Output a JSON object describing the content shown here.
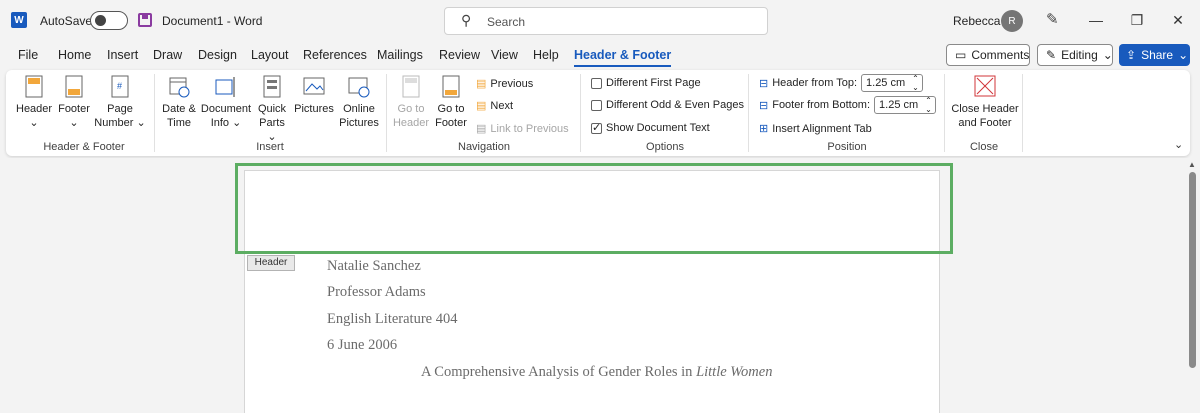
{
  "titlebar": {
    "app_icon": "W",
    "autosave_label": "AutoSave",
    "doc_title": "Document1  -  Word",
    "search_placeholder": "Search",
    "user_name": "Rebecca",
    "avatar_initial": "R",
    "minimize": "—",
    "restore": "❐",
    "close": "✕"
  },
  "menu": {
    "tabs": [
      "File",
      "Home",
      "Insert",
      "Draw",
      "Design",
      "Layout",
      "References",
      "Mailings",
      "Review",
      "View",
      "Help",
      "Header & Footer"
    ],
    "comments": "Comments",
    "editing": "Editing",
    "share": "Share"
  },
  "ribbon": {
    "header_footer": {
      "header": "Header",
      "header_caret": "⌄",
      "footer": "Footer",
      "footer_caret": "⌄",
      "page_number": "Page",
      "page_number_2": "Number ⌄",
      "label": "Header & Footer"
    },
    "insert": {
      "date_time": "Date &",
      "date_time_2": "Time",
      "doc_info": "Document",
      "doc_info_2": "Info ⌄",
      "quick_parts": "Quick",
      "quick_parts_2": "Parts ⌄",
      "pictures": "Pictures",
      "online_pictures": "Online",
      "online_pictures_2": "Pictures",
      "label": "Insert"
    },
    "navigation": {
      "go_to_header": "Go to",
      "go_to_header_2": "Header",
      "go_to_footer": "Go to",
      "go_to_footer_2": "Footer",
      "previous": "Previous",
      "next": "Next",
      "link_to_previous": "Link to Previous",
      "label": "Navigation"
    },
    "options": {
      "different_first_page": "Different First Page",
      "different_odd_even": "Different Odd & Even Pages",
      "show_document_text": "Show Document Text",
      "label": "Options"
    },
    "position": {
      "header_from_top": "Header from Top:",
      "header_value": "1.25 cm",
      "footer_from_bottom": "Footer from Bottom:",
      "footer_value": "1.25 cm",
      "insert_alignment_tab": "Insert Alignment Tab",
      "label": "Position"
    },
    "close": {
      "close_label": "Close Header",
      "close_label_2": "and Footer",
      "label": "Close"
    }
  },
  "document": {
    "header_tag": "Header",
    "lines": [
      "Natalie Sanchez",
      "Professor Adams",
      "English Literature 404",
      "6 June 2006"
    ],
    "title_prefix": "A Comprehensive Analysis of Gender Roles in ",
    "title_italic": "Little Women"
  },
  "colors": {
    "accent": "#185abd",
    "header_highlight": "#5cad62"
  }
}
